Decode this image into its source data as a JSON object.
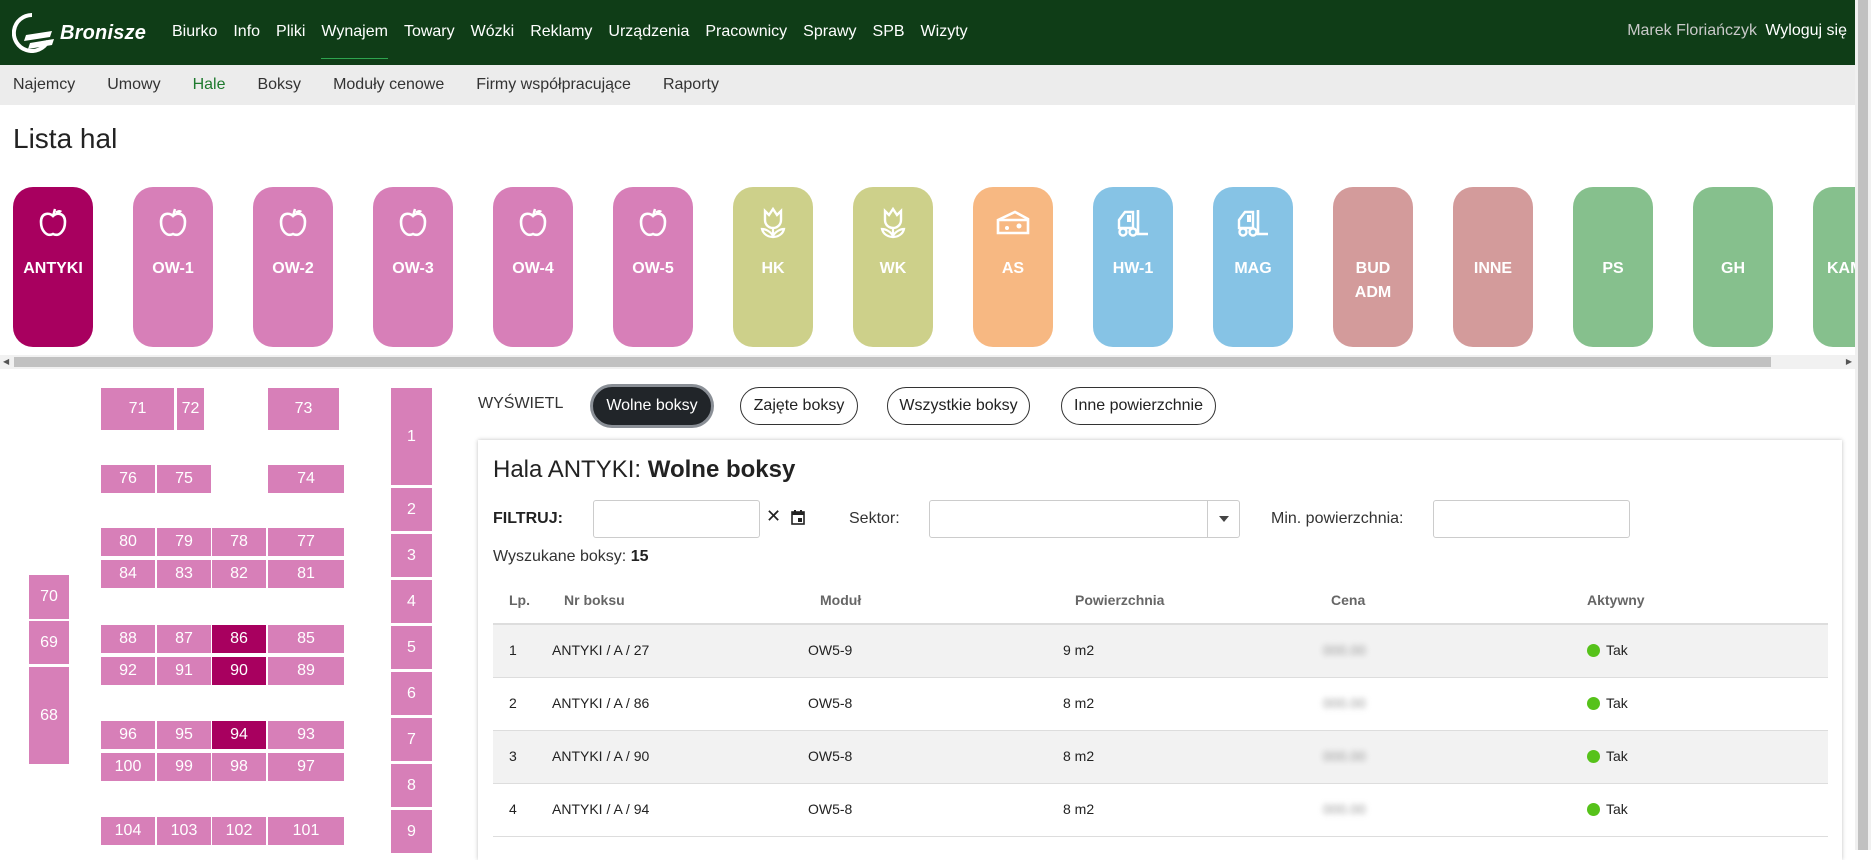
{
  "brand": {
    "name": "Bronisze"
  },
  "topnav": {
    "items": [
      {
        "label": "Biurko"
      },
      {
        "label": "Info"
      },
      {
        "label": "Pliki"
      },
      {
        "label": "Wynajem"
      },
      {
        "label": "Towary"
      },
      {
        "label": "Wózki"
      },
      {
        "label": "Reklamy"
      },
      {
        "label": "Urządzenia"
      },
      {
        "label": "Pracownicy"
      },
      {
        "label": "Sprawy"
      },
      {
        "label": "SPB"
      },
      {
        "label": "Wizyty"
      }
    ],
    "active": "Wynajem",
    "user": "Marek Floriańczyk",
    "logout": "Wyloguj się"
  },
  "subnav": {
    "items": [
      {
        "label": "Najemcy"
      },
      {
        "label": "Umowy"
      },
      {
        "label": "Hale"
      },
      {
        "label": "Boksy"
      },
      {
        "label": "Moduły cenowe"
      },
      {
        "label": "Firmy współpracujące"
      },
      {
        "label": "Raporty"
      }
    ],
    "active": "Hale"
  },
  "page": {
    "title": "Lista hal"
  },
  "halls": [
    {
      "label": "ANTYKI",
      "icon": "apple-icon",
      "color": "#a8005f",
      "selected": true
    },
    {
      "label": "OW-1",
      "icon": "apple-icon",
      "color": "#d77fb8"
    },
    {
      "label": "OW-2",
      "icon": "apple-icon",
      "color": "#d77fb8"
    },
    {
      "label": "OW-3",
      "icon": "apple-icon",
      "color": "#d77fb8"
    },
    {
      "label": "OW-4",
      "icon": "apple-icon",
      "color": "#d77fb8"
    },
    {
      "label": "OW-5",
      "icon": "apple-icon",
      "color": "#d77fb8"
    },
    {
      "label": "HK",
      "icon": "flower-icon",
      "color": "#cdd08a"
    },
    {
      "label": "WK",
      "icon": "flower-icon",
      "color": "#cdd08a"
    },
    {
      "label": "AS",
      "icon": "cheese-icon",
      "color": "#f7b882"
    },
    {
      "label": "HW-1",
      "icon": "forklift-icon",
      "color": "#86c3e5"
    },
    {
      "label": "MAG",
      "icon": "forklift-icon",
      "color": "#86c3e5"
    },
    {
      "label": "BUD ADM",
      "icon": "",
      "color": "#d39b9b"
    },
    {
      "label": "INNE",
      "icon": "",
      "color": "#d39b9b"
    },
    {
      "label": "PS",
      "icon": "",
      "color": "#86c08d"
    },
    {
      "label": "GH",
      "icon": "",
      "color": "#86c08d"
    },
    {
      "label": "KAM",
      "icon": "",
      "color": "#86c08d"
    }
  ],
  "map": {
    "boxes": [
      "71",
      "72",
      "73",
      "76",
      "75",
      "74",
      "80",
      "79",
      "78",
      "77",
      "84",
      "83",
      "82",
      "81",
      "70",
      "69",
      "68",
      "88",
      "87",
      "86",
      "85",
      "92",
      "91",
      "90",
      "89",
      "96",
      "95",
      "94",
      "93",
      "100",
      "99",
      "98",
      "97",
      "104",
      "103",
      "102",
      "101",
      "1",
      "2",
      "3",
      "4",
      "5",
      "6",
      "7",
      "8",
      "9"
    ],
    "highlighted": [
      "86",
      "90",
      "94"
    ]
  },
  "display": {
    "label": "WYŚWIETL",
    "options": [
      "Wolne boksy",
      "Zajęte boksy",
      "Wszystkie boksy",
      "Inne powierzchnie"
    ],
    "active": "Wolne boksy"
  },
  "panel": {
    "title_prefix": "Hala ANTYKI: ",
    "title_bold": "Wolne boksy",
    "filter_label": "FILTRUJ:",
    "clear": "✕",
    "sektor_label": "Sektor:",
    "min_label": "Min. powierzchnia:",
    "found_label": "Wyszukane boksy: ",
    "found_count": "15"
  },
  "table": {
    "headers": [
      "Lp.",
      "Nr boksu",
      "Moduł",
      "Powierzchnia",
      "Cena",
      "Aktywny"
    ],
    "rows": [
      {
        "lp": "1",
        "nr": "ANTYKI / A / 27",
        "modul": "OW5-9",
        "pow": "9 m2",
        "cena": "000.00",
        "aktywny": "Tak"
      },
      {
        "lp": "2",
        "nr": "ANTYKI / A / 86",
        "modul": "OW5-8",
        "pow": "8 m2",
        "cena": "000.00",
        "aktywny": "Tak"
      },
      {
        "lp": "3",
        "nr": "ANTYKI / A / 90",
        "modul": "OW5-8",
        "pow": "8 m2",
        "cena": "000.00",
        "aktywny": "Tak"
      },
      {
        "lp": "4",
        "nr": "ANTYKI / A / 94",
        "modul": "OW5-8",
        "pow": "8 m2",
        "cena": "000.00",
        "aktywny": "Tak"
      }
    ]
  }
}
